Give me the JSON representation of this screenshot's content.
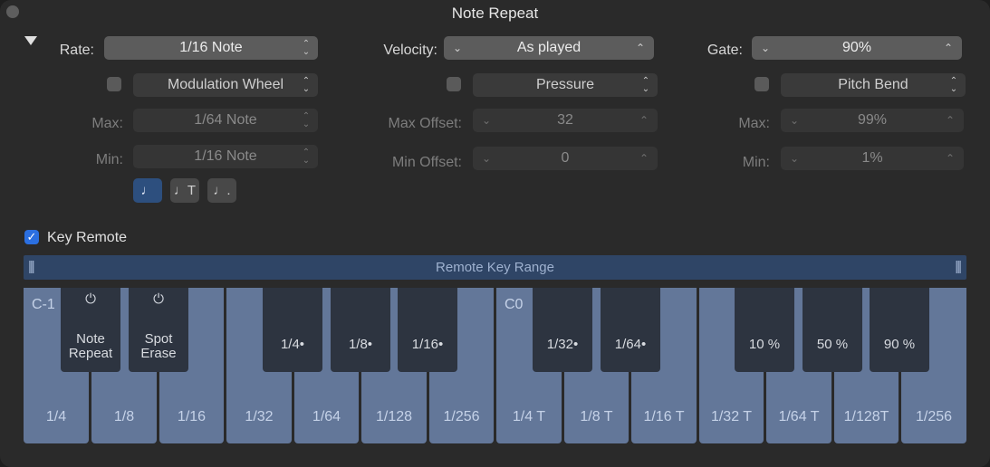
{
  "window": {
    "title": "Note Repeat"
  },
  "rate": {
    "label": "Rate:",
    "value": "1/16 Note",
    "mod_source": "Modulation Wheel",
    "max_label": "Max:",
    "max_value": "1/64 Note",
    "min_label": "Min:",
    "min_value": "1/16 Note",
    "note_buttons": [
      {
        "glyph": "♩",
        "active": true
      },
      {
        "glyph": "♩T",
        "active": false
      },
      {
        "glyph": "♩.",
        "active": false
      }
    ]
  },
  "velocity": {
    "label": "Velocity:",
    "value": "As played",
    "mod_source": "Pressure",
    "max_offset_label": "Max Offset:",
    "max_offset_value": "32",
    "min_offset_label": "Min Offset:",
    "min_offset_value": "0"
  },
  "gate": {
    "label": "Gate:",
    "value": "90%",
    "mod_source": "Pitch Bend",
    "max_label": "Max:",
    "max_value": "99%",
    "min_label": "Min:",
    "min_value": "1%"
  },
  "key_remote": {
    "label": "Key Remote",
    "checked": true,
    "checkmark": "✓",
    "range_label": "Remote Key Range",
    "grip_glyph": "|||"
  },
  "keyboard": {
    "octave_labels": [
      "C-1",
      "C0"
    ],
    "white_keys": [
      "1/4",
      "1/8",
      "1/16",
      "1/32",
      "1/64",
      "1/128",
      "1/256",
      "1/4 T",
      "1/8 T",
      "1/16 T",
      "1/32 T",
      "1/64 T",
      "1/128T",
      "1/256"
    ],
    "black_keys": [
      {
        "power": "⏻",
        "line1": "Note",
        "line2": "Repeat"
      },
      {
        "power": "⏻",
        "line1": "Spot",
        "line2": "Erase"
      },
      {
        "label": "1/4•"
      },
      {
        "label": "1/8•"
      },
      {
        "label": "1/16•"
      },
      {
        "label": "1/32•"
      },
      {
        "label": "1/64•"
      },
      {
        "label": "10 %"
      },
      {
        "label": "50 %"
      },
      {
        "label": "90 %"
      }
    ]
  },
  "icons": {
    "updown": "⌃⌄",
    "chev_down": "⌄",
    "chev_up": "⌃"
  },
  "colors": {
    "accent": "#2b6fe0",
    "white_key": "#637799",
    "black_key": "#2d3440",
    "range_bar": "#2f4566"
  }
}
